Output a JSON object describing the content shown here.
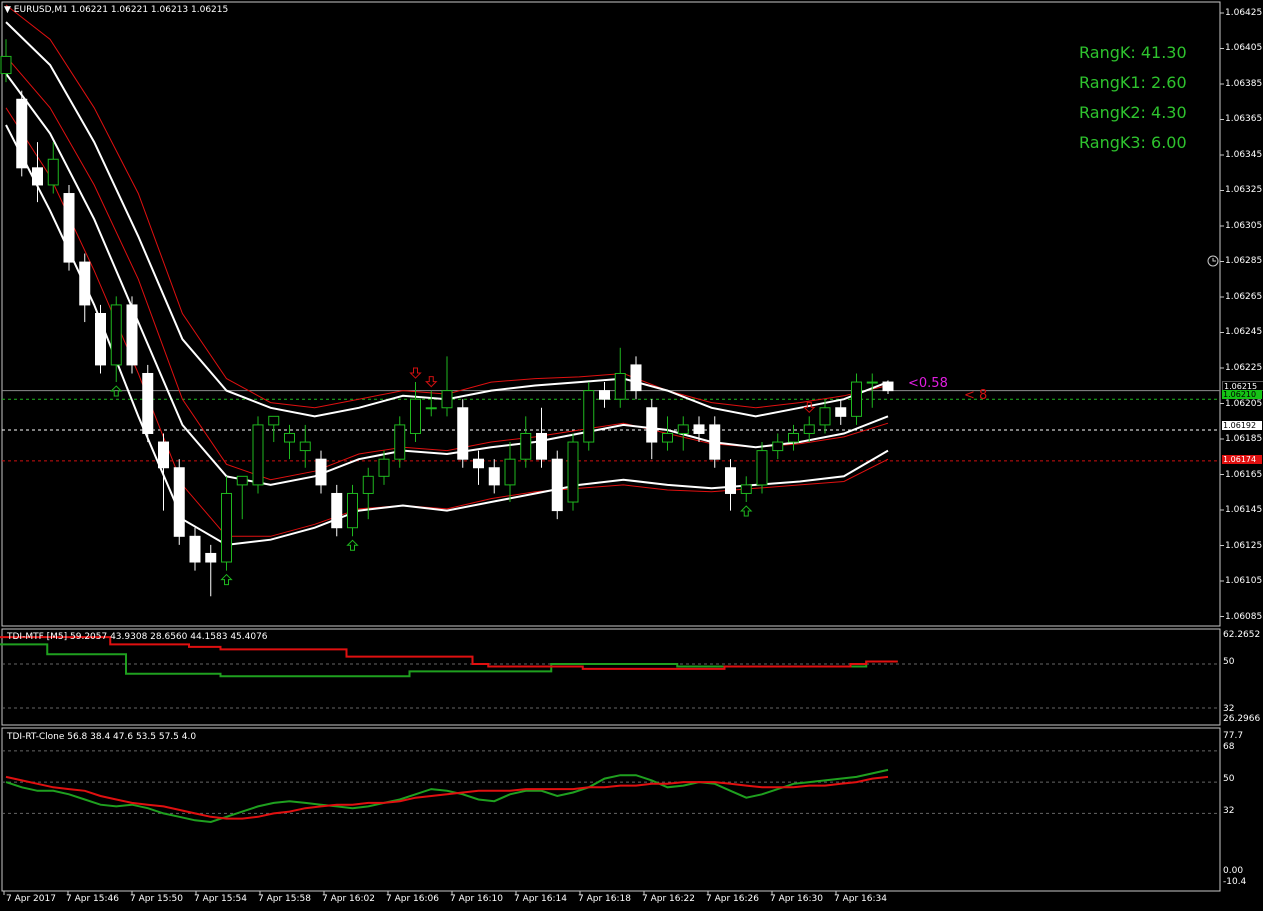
{
  "main": {
    "title": "EURUSD,M1  1.06221 1.06221 1.06213 1.06215",
    "price_ticks": [
      "1.06425",
      "1.06405",
      "1.06385",
      "1.06365",
      "1.06345",
      "1.06325",
      "1.06305",
      "1.06285",
      "1.06265",
      "1.06245",
      "1.06225",
      "1.06205",
      "1.06185",
      "1.06165",
      "1.06145",
      "1.06125",
      "1.06105",
      "1.06085"
    ],
    "tags": {
      "bid": "1.06215",
      "green": "1.06210",
      "white": "1.06192",
      "red": "1.06174"
    },
    "info": [
      "RangK: 41.30",
      "RangK1: 2.60",
      "RangK2: 4.30",
      "RangK3: 6.00"
    ],
    "note_magenta": "<0.58",
    "note_red": "< 8"
  },
  "sub1": {
    "title": "TDI-MTF [M5] 59.2057 43.9308 28.6560 44.1583 45.4076",
    "ticks": [
      "62.2652",
      "50",
      "32",
      "26.2966"
    ]
  },
  "sub2": {
    "title": "TDI-RT-Clone 56.8 38.4 47.6 53.5 57.5 4.0",
    "ticks": [
      "77.7",
      "68",
      "50",
      "32",
      "0.00",
      "-10.4"
    ]
  },
  "time_axis": [
    "7 Apr 2017",
    "7 Apr 15:46",
    "7 Apr 15:50",
    "7 Apr 15:54",
    "7 Apr 15:58",
    "7 Apr 16:02",
    "7 Apr 16:06",
    "7 Apr 16:10",
    "7 Apr 16:14",
    "7 Apr 16:18",
    "7 Apr 16:22",
    "7 Apr 16:26",
    "7 Apr 16:30",
    "7 Apr 16:34"
  ],
  "chart_data": {
    "type": "candlestick",
    "symbol": "EURUSD",
    "timeframe": "M1",
    "candles": [
      {
        "o": 1.064,
        "h": 1.0642,
        "l": 1.06395,
        "c": 1.0641
      },
      {
        "o": 1.06385,
        "h": 1.0639,
        "l": 1.0634,
        "c": 1.06345
      },
      {
        "o": 1.06345,
        "h": 1.0636,
        "l": 1.06325,
        "c": 1.06335
      },
      {
        "o": 1.06335,
        "h": 1.0636,
        "l": 1.0633,
        "c": 1.0635
      },
      {
        "o": 1.0633,
        "h": 1.06335,
        "l": 1.06285,
        "c": 1.0629
      },
      {
        "o": 1.0629,
        "h": 1.06295,
        "l": 1.06255,
        "c": 1.06265
      },
      {
        "o": 1.0626,
        "h": 1.06265,
        "l": 1.06225,
        "c": 1.0623
      },
      {
        "o": 1.0623,
        "h": 1.0627,
        "l": 1.0622,
        "c": 1.06265
      },
      {
        "o": 1.06265,
        "h": 1.0627,
        "l": 1.06225,
        "c": 1.0623
      },
      {
        "o": 1.06225,
        "h": 1.0623,
        "l": 1.06185,
        "c": 1.0619
      },
      {
        "o": 1.06185,
        "h": 1.0619,
        "l": 1.06145,
        "c": 1.0617
      },
      {
        "o": 1.0617,
        "h": 1.06175,
        "l": 1.06125,
        "c": 1.0613
      },
      {
        "o": 1.0613,
        "h": 1.06135,
        "l": 1.0611,
        "c": 1.06115
      },
      {
        "o": 1.0612,
        "h": 1.06125,
        "l": 1.06095,
        "c": 1.06115
      },
      {
        "o": 1.06115,
        "h": 1.06165,
        "l": 1.0611,
        "c": 1.06155
      },
      {
        "o": 1.0616,
        "h": 1.06165,
        "l": 1.0614,
        "c": 1.06165
      },
      {
        "o": 1.0616,
        "h": 1.062,
        "l": 1.06155,
        "c": 1.06195
      },
      {
        "o": 1.06195,
        "h": 1.062,
        "l": 1.06185,
        "c": 1.062
      },
      {
        "o": 1.06185,
        "h": 1.06195,
        "l": 1.06175,
        "c": 1.0619
      },
      {
        "o": 1.0618,
        "h": 1.06195,
        "l": 1.0617,
        "c": 1.06185
      },
      {
        "o": 1.06175,
        "h": 1.0618,
        "l": 1.06155,
        "c": 1.0616
      },
      {
        "o": 1.06155,
        "h": 1.0616,
        "l": 1.0613,
        "c": 1.06135
      },
      {
        "o": 1.06135,
        "h": 1.0616,
        "l": 1.0613,
        "c": 1.06155
      },
      {
        "o": 1.06155,
        "h": 1.0617,
        "l": 1.0614,
        "c": 1.06165
      },
      {
        "o": 1.06165,
        "h": 1.0618,
        "l": 1.0616,
        "c": 1.06175
      },
      {
        "o": 1.06175,
        "h": 1.062,
        "l": 1.0617,
        "c": 1.06195
      },
      {
        "o": 1.0619,
        "h": 1.0622,
        "l": 1.06185,
        "c": 1.0621
      },
      {
        "o": 1.06205,
        "h": 1.06215,
        "l": 1.062,
        "c": 1.06205
      },
      {
        "o": 1.06205,
        "h": 1.06235,
        "l": 1.062,
        "c": 1.06215
      },
      {
        "o": 1.06205,
        "h": 1.0621,
        "l": 1.0617,
        "c": 1.06175
      },
      {
        "o": 1.06175,
        "h": 1.0618,
        "l": 1.0616,
        "c": 1.0617
      },
      {
        "o": 1.0617,
        "h": 1.06175,
        "l": 1.06155,
        "c": 1.0616
      },
      {
        "o": 1.0616,
        "h": 1.06185,
        "l": 1.0615,
        "c": 1.06175
      },
      {
        "o": 1.06175,
        "h": 1.062,
        "l": 1.0617,
        "c": 1.0619
      },
      {
        "o": 1.0619,
        "h": 1.06205,
        "l": 1.0617,
        "c": 1.06175
      },
      {
        "o": 1.06175,
        "h": 1.0618,
        "l": 1.0614,
        "c": 1.06145
      },
      {
        "o": 1.0615,
        "h": 1.0619,
        "l": 1.06145,
        "c": 1.06185
      },
      {
        "o": 1.06185,
        "h": 1.0622,
        "l": 1.0618,
        "c": 1.06215
      },
      {
        "o": 1.06215,
        "h": 1.0622,
        "l": 1.06205,
        "c": 1.0621
      },
      {
        "o": 1.0621,
        "h": 1.0624,
        "l": 1.06205,
        "c": 1.06225
      },
      {
        "o": 1.0623,
        "h": 1.06235,
        "l": 1.0621,
        "c": 1.06215
      },
      {
        "o": 1.06205,
        "h": 1.0621,
        "l": 1.06175,
        "c": 1.06185
      },
      {
        "o": 1.06185,
        "h": 1.062,
        "l": 1.0618,
        "c": 1.0619
      },
      {
        "o": 1.0619,
        "h": 1.062,
        "l": 1.0618,
        "c": 1.06195
      },
      {
        "o": 1.06195,
        "h": 1.062,
        "l": 1.06185,
        "c": 1.0619
      },
      {
        "o": 1.06195,
        "h": 1.062,
        "l": 1.0617,
        "c": 1.06175
      },
      {
        "o": 1.0617,
        "h": 1.06175,
        "l": 1.06145,
        "c": 1.06155
      },
      {
        "o": 1.06155,
        "h": 1.06165,
        "l": 1.0615,
        "c": 1.0616
      },
      {
        "o": 1.0616,
        "h": 1.06185,
        "l": 1.06155,
        "c": 1.0618
      },
      {
        "o": 1.0618,
        "h": 1.0619,
        "l": 1.06175,
        "c": 1.06185
      },
      {
        "o": 1.06185,
        "h": 1.06195,
        "l": 1.0618,
        "c": 1.0619
      },
      {
        "o": 1.0619,
        "h": 1.062,
        "l": 1.06185,
        "c": 1.06195
      },
      {
        "o": 1.06195,
        "h": 1.0621,
        "l": 1.0619,
        "c": 1.06205
      },
      {
        "o": 1.06205,
        "h": 1.0621,
        "l": 1.06195,
        "c": 1.062
      },
      {
        "o": 1.062,
        "h": 1.06225,
        "l": 1.06195,
        "c": 1.0622
      },
      {
        "o": 1.0622,
        "h": 1.06225,
        "l": 1.06205,
        "c": 1.0622
      },
      {
        "o": 1.0622,
        "h": 1.06221,
        "l": 1.06213,
        "c": 1.06215
      }
    ],
    "bands_white": {
      "upper": [
        1.0643,
        1.06405,
        1.0636,
        1.06305,
        1.06245,
        1.06215,
        1.06205,
        1.062,
        1.06205,
        1.06212,
        1.0621,
        1.06215,
        1.06218,
        1.0622,
        1.06222,
        1.06215,
        1.06205,
        1.062,
        1.06205,
        1.0621,
        1.0622
      ],
      "middle": [
        1.064,
        1.06365,
        1.06315,
        1.06255,
        1.06195,
        1.06165,
        1.0616,
        1.06165,
        1.06175,
        1.0618,
        1.06178,
        1.06182,
        1.06185,
        1.0619,
        1.06195,
        1.06192,
        1.06185,
        1.06182,
        1.06185,
        1.0619,
        1.062
      ],
      "lower": [
        1.0637,
        1.0632,
        1.06265,
        1.062,
        1.0614,
        1.06125,
        1.06128,
        1.06135,
        1.06145,
        1.06148,
        1.06145,
        1.0615,
        1.06155,
        1.0616,
        1.06163,
        1.0616,
        1.06158,
        1.0616,
        1.06162,
        1.06165,
        1.0618
      ]
    },
    "bands_red": {
      "upper": [
        1.0644,
        1.0642,
        1.0638,
        1.0633,
        1.0626,
        1.06222,
        1.06208,
        1.06205,
        1.0621,
        1.06215,
        1.06213,
        1.0622,
        1.06222,
        1.06223,
        1.06225,
        1.06215,
        1.06208,
        1.06205,
        1.06208,
        1.06212,
        1.06218
      ],
      "middle": [
        1.0641,
        1.0638,
        1.06335,
        1.0628,
        1.0621,
        1.06172,
        1.06163,
        1.06168,
        1.06178,
        1.06182,
        1.0618,
        1.06185,
        1.06188,
        1.06192,
        1.06196,
        1.0619,
        1.06184,
        1.06182,
        1.06184,
        1.06188,
        1.06196
      ],
      "lower": [
        1.0638,
        1.0634,
        1.06285,
        1.06225,
        1.0616,
        1.0613,
        1.0613,
        1.06137,
        1.06146,
        1.06148,
        1.06146,
        1.06152,
        1.06156,
        1.06158,
        1.0616,
        1.06157,
        1.06156,
        1.06158,
        1.0616,
        1.06162,
        1.06175
      ]
    },
    "levels": {
      "bid": 1.06215,
      "green": 1.0621,
      "white": 1.06192,
      "red": 1.06174
    },
    "arrows_up": [
      7,
      14,
      22,
      47
    ],
    "arrows_down": [
      26,
      27,
      51
    ],
    "price_range": [
      1.0608,
      1.0644
    ],
    "tdi_mtf": {
      "red": [
        61,
        61,
        61,
        61,
        61,
        61,
        61,
        58,
        58,
        58,
        58,
        58,
        57,
        57,
        56,
        56,
        56,
        56,
        56,
        56,
        56,
        56,
        53,
        53,
        53,
        53,
        53,
        53,
        53,
        53,
        50,
        49,
        49,
        49,
        49,
        49,
        49,
        48,
        48,
        48,
        48,
        48,
        48,
        48,
        48,
        48,
        49,
        49,
        49,
        49,
        49,
        49,
        49,
        49,
        50,
        51,
        51
      ],
      "green": [
        58,
        58,
        58,
        54,
        54,
        54,
        54,
        54,
        46,
        46,
        46,
        46,
        46,
        46,
        45,
        45,
        45,
        45,
        45,
        45,
        45,
        45,
        45,
        45,
        45,
        45,
        47,
        47,
        47,
        47,
        47,
        47,
        47,
        47,
        47,
        50,
        50,
        50,
        50,
        50,
        50,
        50,
        50,
        49,
        49,
        49,
        49,
        49,
        49,
        49,
        49,
        49,
        49,
        49,
        49,
        51,
        51
      ],
      "range": [
        26.2966,
        62.2652
      ]
    },
    "tdi_rt": {
      "red": [
        53,
        51,
        49,
        47,
        46,
        45,
        42,
        40,
        38,
        37,
        36,
        34,
        32,
        30,
        29,
        29,
        30,
        32,
        33,
        35,
        36,
        37,
        37,
        38,
        38,
        39,
        41,
        42,
        43,
        44,
        45,
        45,
        45,
        46,
        46,
        46,
        46,
        47,
        47,
        48,
        48,
        49,
        49,
        50,
        50,
        50,
        49,
        48,
        47,
        47,
        47,
        48,
        48,
        49,
        50,
        52,
        53
      ],
      "green": [
        50,
        47,
        45,
        45,
        43,
        40,
        37,
        36,
        37,
        35,
        32,
        30,
        28,
        27,
        30,
        33,
        36,
        38,
        39,
        38,
        37,
        36,
        35,
        36,
        38,
        40,
        43,
        46,
        45,
        43,
        40,
        39,
        43,
        45,
        45,
        42,
        44,
        47,
        52,
        54,
        54,
        51,
        47,
        48,
        50,
        49,
        45,
        41,
        43,
        46,
        49,
        50,
        51,
        52,
        53,
        55,
        57
      ],
      "range": [
        -10.4,
        77.7
      ]
    }
  }
}
